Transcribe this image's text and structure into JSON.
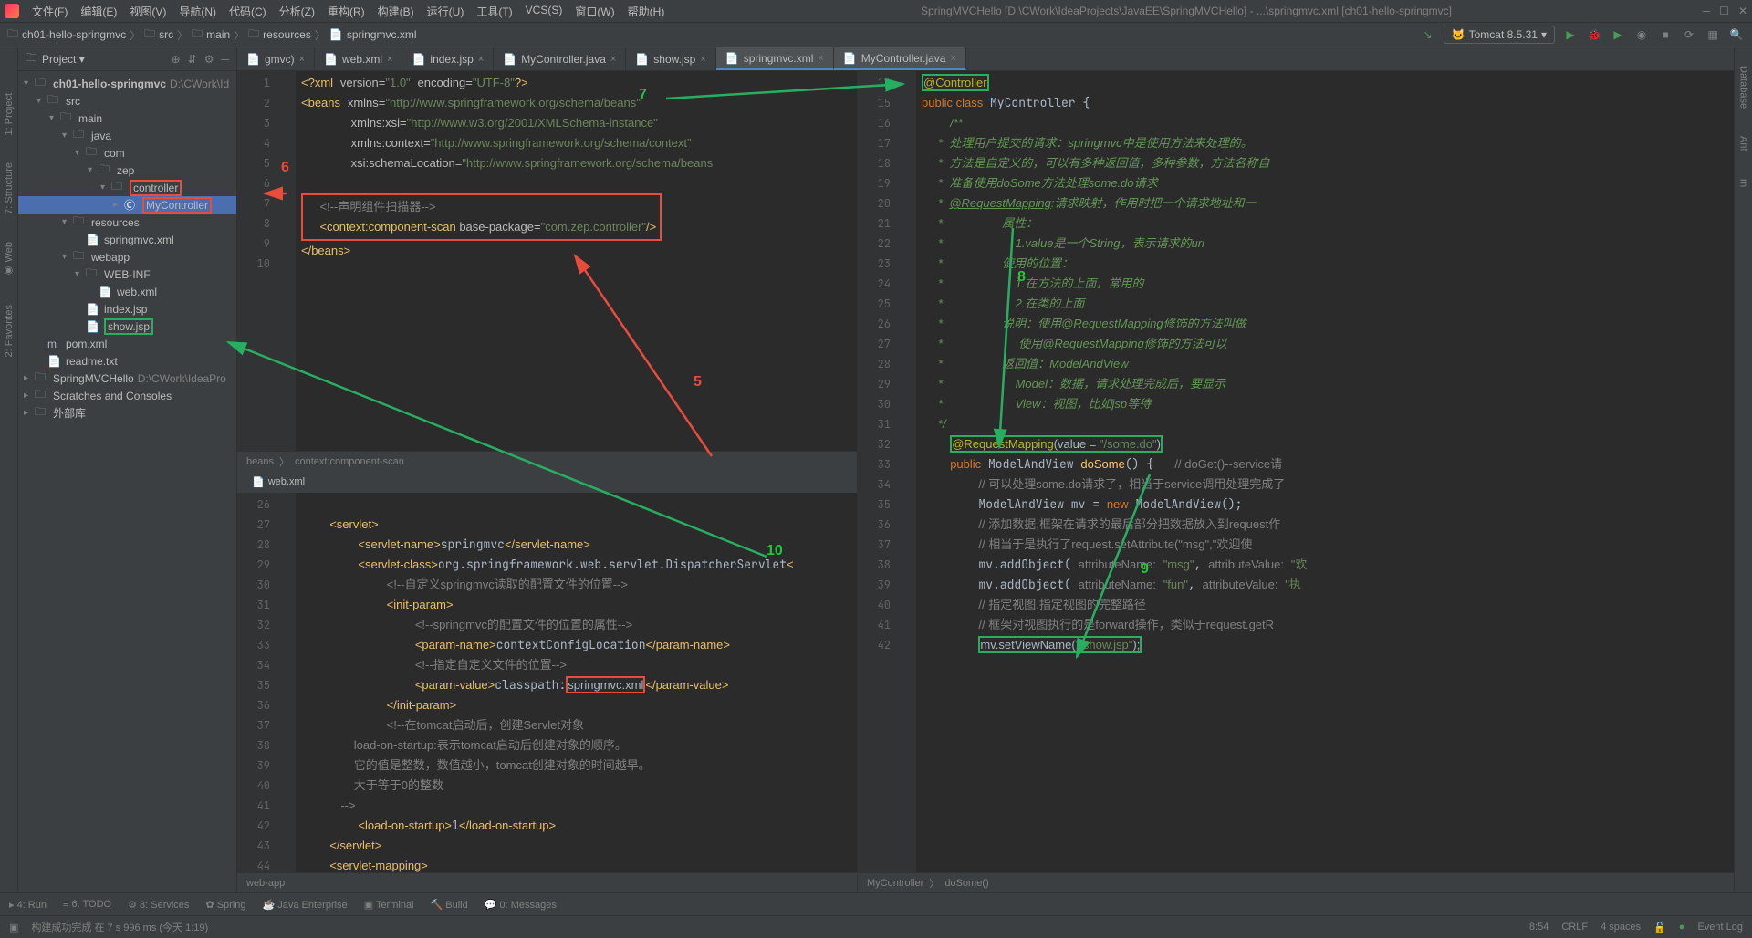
{
  "window": {
    "title": "SpringMVCHello [D:\\CWork\\IdeaProjects\\JavaEE\\SpringMVCHello] - ...\\springmvc.xml [ch01-hello-springmvc]"
  },
  "menu": [
    "文件(F)",
    "编辑(E)",
    "视图(V)",
    "导航(N)",
    "代码(C)",
    "分析(Z)",
    "重构(R)",
    "构建(B)",
    "运行(U)",
    "工具(T)",
    "VCS(S)",
    "窗口(W)",
    "帮助(H)"
  ],
  "breadcrumb": [
    "ch01-hello-springmvc",
    "src",
    "main",
    "resources",
    "springmvc.xml"
  ],
  "runConfig": "Tomcat 8.5.31",
  "tree": {
    "root": "ch01-hello-springmvc",
    "rootPath": "D:\\CWork\\Id",
    "items": [
      {
        "indent": 1,
        "arrow": "▾",
        "icon": "folder",
        "label": "src"
      },
      {
        "indent": 2,
        "arrow": "▾",
        "icon": "folder",
        "label": "main"
      },
      {
        "indent": 3,
        "arrow": "▾",
        "icon": "folder",
        "label": "java"
      },
      {
        "indent": 4,
        "arrow": "▾",
        "icon": "folder",
        "label": "com"
      },
      {
        "indent": 5,
        "arrow": "▾",
        "icon": "folder",
        "label": "zep"
      },
      {
        "indent": 6,
        "arrow": "▾",
        "icon": "folder",
        "label": "controller",
        "box": "red"
      },
      {
        "indent": 7,
        "arrow": "▸",
        "icon": "class",
        "label": "MyController",
        "box": "red",
        "selected": true
      },
      {
        "indent": 3,
        "arrow": "▾",
        "icon": "folder",
        "label": "resources"
      },
      {
        "indent": 4,
        "arrow": "",
        "icon": "xml",
        "label": "springmvc.xml"
      },
      {
        "indent": 3,
        "arrow": "▾",
        "icon": "folder",
        "label": "webapp"
      },
      {
        "indent": 4,
        "arrow": "▾",
        "icon": "folder",
        "label": "WEB-INF"
      },
      {
        "indent": 5,
        "arrow": "",
        "icon": "xml",
        "label": "web.xml"
      },
      {
        "indent": 4,
        "arrow": "",
        "icon": "jsp",
        "label": "index.jsp"
      },
      {
        "indent": 4,
        "arrow": "",
        "icon": "jsp",
        "label": "show.jsp",
        "box": "green"
      },
      {
        "indent": 1,
        "arrow": "",
        "icon": "maven",
        "label": "pom.xml"
      },
      {
        "indent": 1,
        "arrow": "",
        "icon": "txt",
        "label": "readme.txt"
      }
    ],
    "extra": [
      {
        "arrow": "▸",
        "label": "SpringMVCHello",
        "path": "D:\\CWork\\IdeaPro"
      },
      {
        "arrow": "▸",
        "label": "Scratches and Consoles"
      },
      {
        "arrow": "▸",
        "label": "外部库"
      }
    ]
  },
  "tabs": [
    "gmvc)",
    "web.xml",
    "index.jsp",
    "MyController.java",
    "show.jsp",
    "springmvc.xml",
    "MyController.java"
  ],
  "activeTab": 5,
  "secondActiveTab": 6,
  "webxmlTab": "web.xml",
  "springmvc_lines": [
    1,
    2,
    3,
    4,
    5,
    6,
    7,
    8,
    9,
    10
  ],
  "springmvc_code": "<?xml version=\"1.0\" encoding=\"UTF-8\"?>\n<beans xmlns=\"http://www.springframework.org/schema/beans\"\n       xmlns:xsi=\"http://www.w3.org/2001/XMLSchema-instance\"\n       xmlns:context=\"http://www.springframework.org/schema/context\"\n       xsi:schemaLocation=\"http://www.springframework.org/schema/beans\n\n    <!--声明组件扫描器-->\n    <context:component-scan base-package=\"com.zep.controller\"/>\n</beans>",
  "springmvc_crumb": [
    "beans",
    "context:component-scan"
  ],
  "webxml_lines": [
    26,
    27,
    28,
    29,
    30,
    31,
    32,
    33,
    34,
    35,
    36,
    37,
    38,
    39,
    40,
    41,
    42,
    43,
    44
  ],
  "webxml_crumb": "web-app",
  "controller_lines": [
    14,
    15,
    16,
    17,
    18,
    19,
    20,
    21,
    22,
    23,
    24,
    25,
    26,
    27,
    28,
    29,
    30,
    31,
    32,
    33,
    34,
    35,
    36,
    37,
    38,
    39,
    40,
    41,
    42
  ],
  "controller_crumb": [
    "MyController",
    "doSome()"
  ],
  "bottomTools": [
    "▸ 4: Run",
    "≡ 6: TODO",
    "⚙ 8: Services",
    "✿ Spring",
    "☕ Java Enterprise",
    "▣ Terminal",
    "🔨 Build",
    "💬 0: Messages"
  ],
  "status": {
    "msg": "构建成功完成 在 7 s 996 ms (今天 1:19)",
    "pos": "8:54",
    "crlf": "CRLF",
    "indent": "4 spaces",
    "eventLog": "Event Log"
  },
  "annotations": {
    "5": "5",
    "6": "6",
    "7": "7",
    "8": "8",
    "9": "9",
    "10": "10"
  }
}
